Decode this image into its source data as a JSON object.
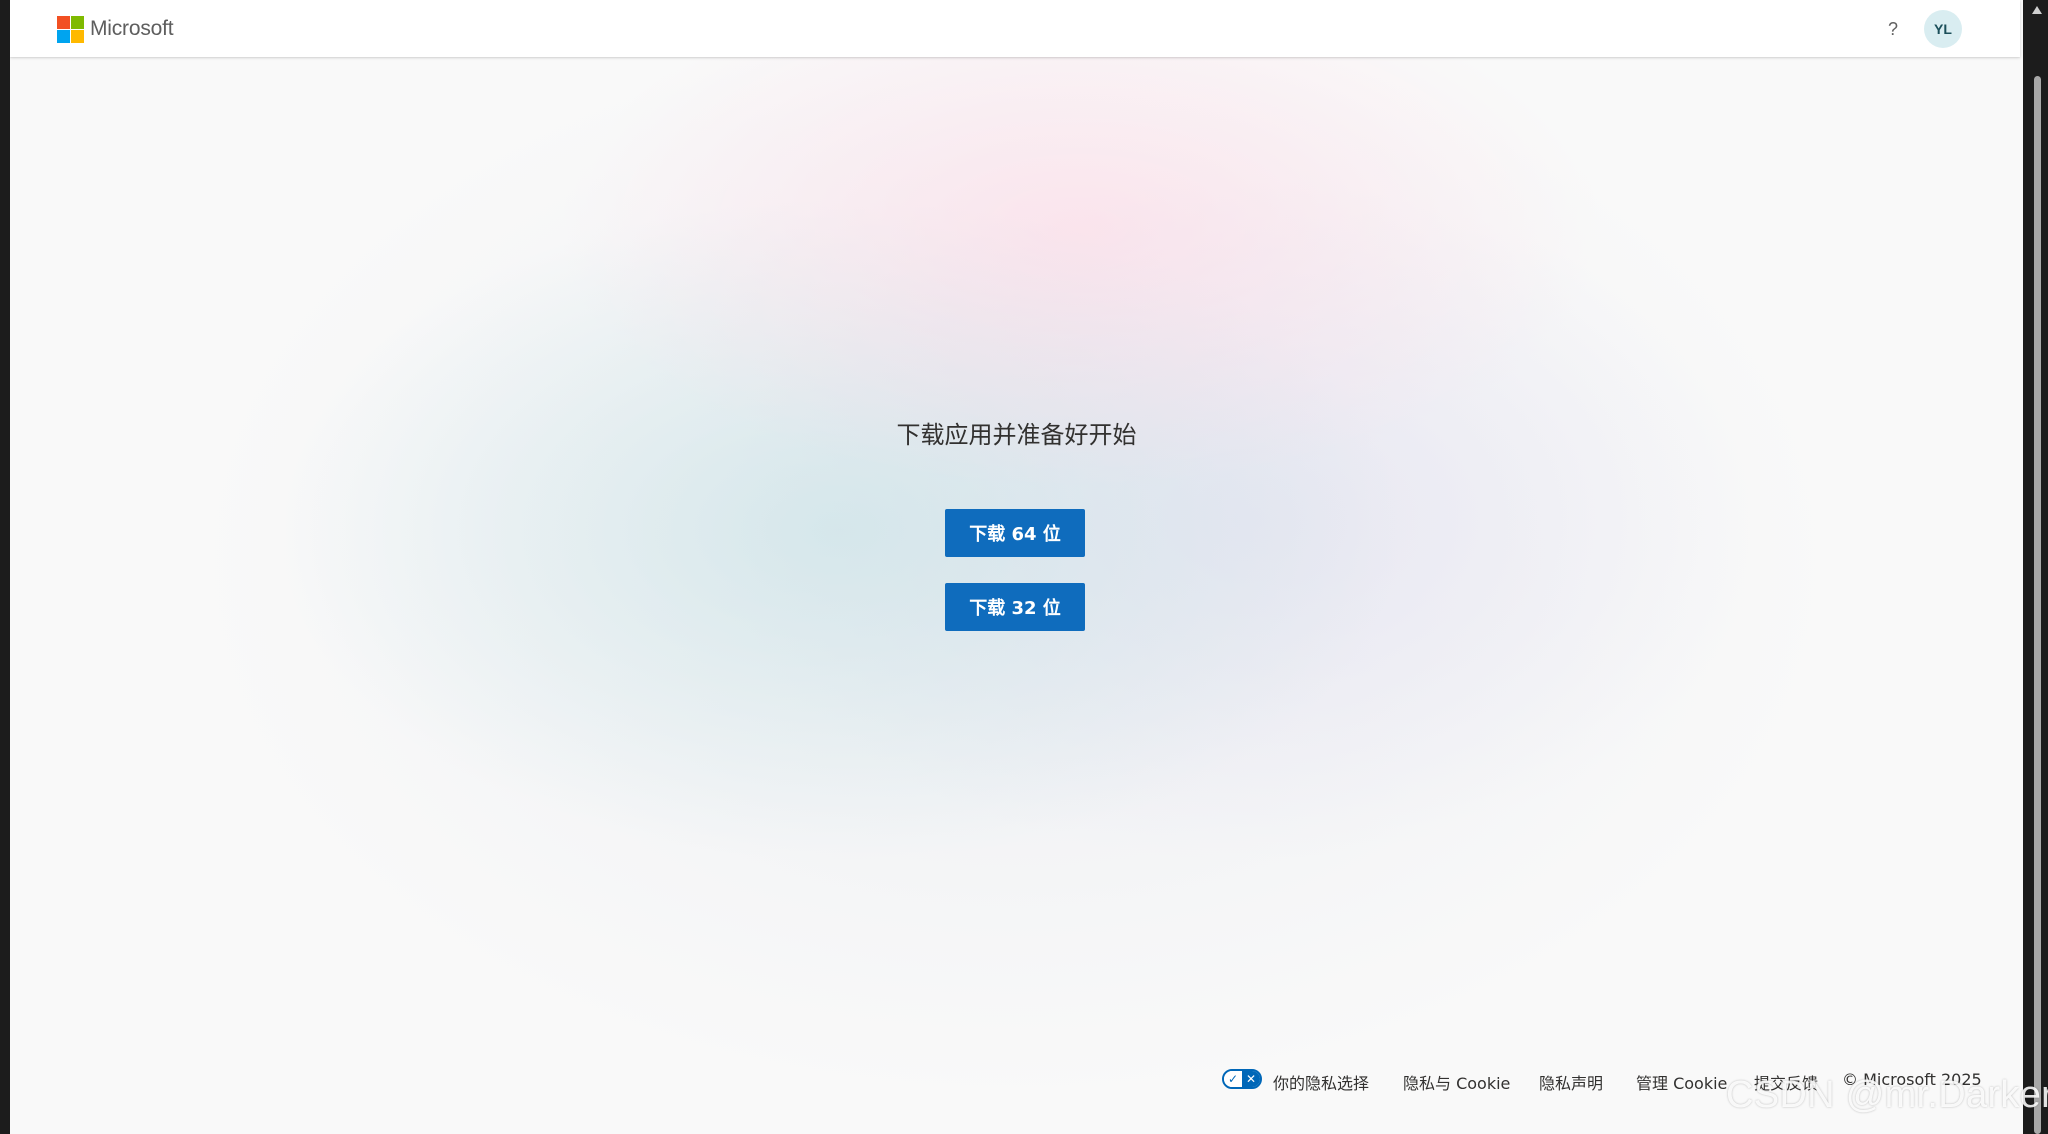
{
  "header": {
    "brand": "Microsoft",
    "help_label": "?",
    "avatar_initials": "YL"
  },
  "logo_colors": {
    "red": "#f25022",
    "green": "#7fba00",
    "blue": "#00a4ef",
    "yellow": "#ffb900"
  },
  "main": {
    "title": "下载应用并准备好开始",
    "download_64_label": "下载 64 位",
    "download_32_label": "下载 32 位"
  },
  "footer": {
    "privacy_choices": "你的隐私选择",
    "privacy_toggle_check": "✓",
    "privacy_toggle_x": "✕",
    "privacy_cookies": "隐私与 Cookie",
    "privacy_statement": "隐私声明",
    "manage_cookies": "管理 Cookie",
    "feedback": "提交反馈",
    "copyright": "© Microsoft 2025"
  },
  "watermark": "CSDN @mr.Darker",
  "colors": {
    "accent": "#0f6cbd",
    "avatar_bg": "#d9edf1",
    "page_bg": "#f9f9f9"
  }
}
